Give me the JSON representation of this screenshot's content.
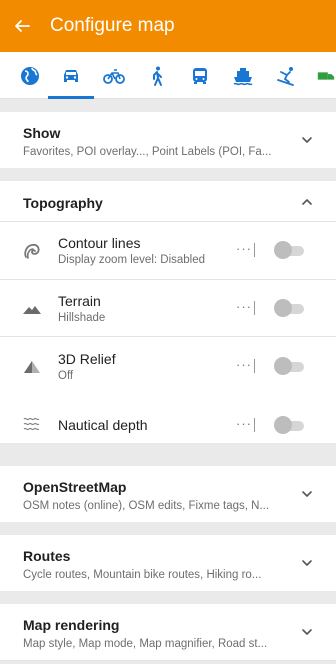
{
  "app_bar": {
    "title": "Configure map",
    "back_icon": "arrow-back-icon",
    "background": "#f28b00"
  },
  "profiles": {
    "items": [
      {
        "name": "browse-map",
        "icon": "globe-icon"
      },
      {
        "name": "car",
        "icon": "car-icon",
        "selected": true
      },
      {
        "name": "bicycle",
        "icon": "bicycle-icon"
      },
      {
        "name": "pedestrian",
        "icon": "walking-icon"
      },
      {
        "name": "public-transport",
        "icon": "bus-icon"
      },
      {
        "name": "boat",
        "icon": "boat-icon"
      },
      {
        "name": "ski",
        "icon": "skiing-icon"
      },
      {
        "name": "truck",
        "icon": "truck-icon"
      }
    ],
    "accent": "#1976d2"
  },
  "sections": {
    "show": {
      "title": "Show",
      "subtitle": "Favorites, POI overlay..., Point Labels (POI, Fa...",
      "expanded": false
    },
    "topography": {
      "title": "Topography",
      "expanded": true,
      "items": [
        {
          "title": "Contour lines",
          "subtitle": "Display zoom level: Disabled",
          "icon": "contour-lines-icon",
          "more": "···",
          "enabled": false
        },
        {
          "title": "Terrain",
          "subtitle": "Hillshade",
          "icon": "mountain-icon",
          "more": "···",
          "enabled": false
        },
        {
          "title": "3D Relief",
          "subtitle": "Off",
          "icon": "relief-3d-icon",
          "more": "···",
          "enabled": false
        },
        {
          "title": "Nautical depth",
          "subtitle": "",
          "icon": "waves-icon",
          "more": "···",
          "enabled": false
        }
      ]
    },
    "osm": {
      "title": "OpenStreetMap",
      "subtitle": "OSM notes (online), OSM edits, Fixme tags, N...",
      "expanded": false
    },
    "routes": {
      "title": "Routes",
      "subtitle": "Cycle routes, Mountain bike routes, Hiking ro...",
      "expanded": false
    },
    "rendering": {
      "title": "Map rendering",
      "subtitle": "Map style, Map mode, Map magnifier, Road st...",
      "expanded": false
    }
  }
}
